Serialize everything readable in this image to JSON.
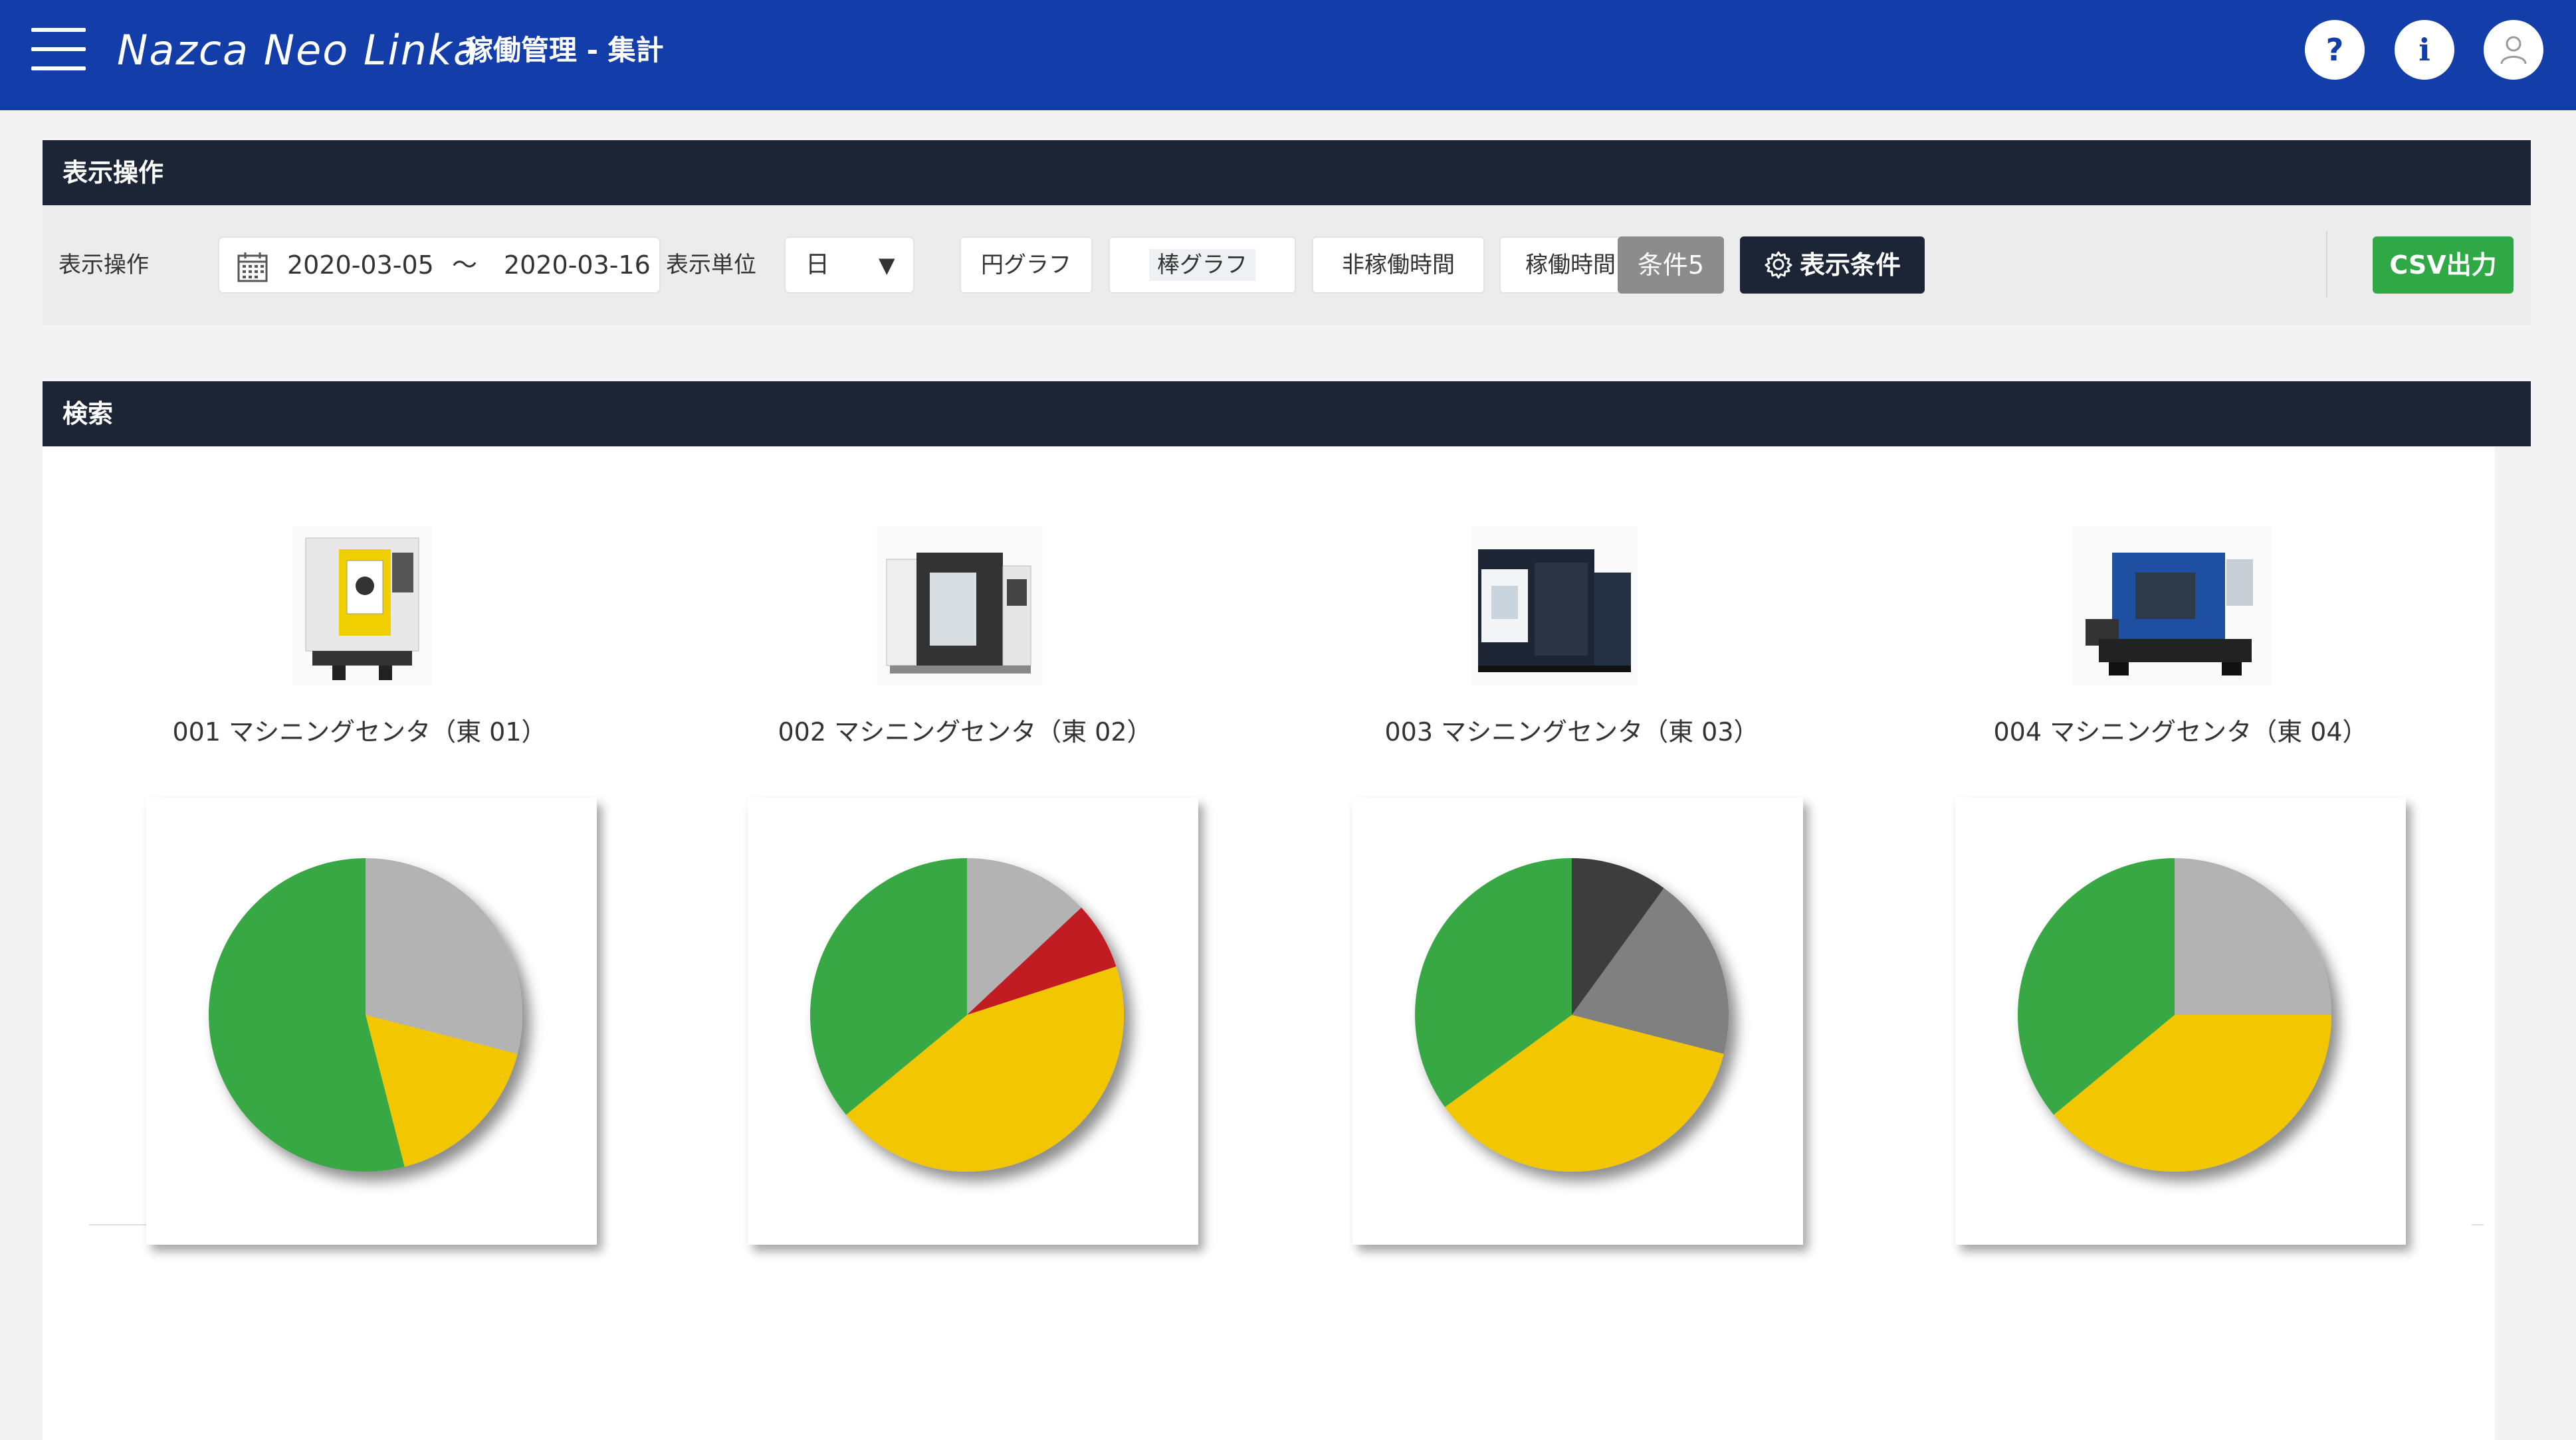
{
  "header": {
    "brand": "Nazca Neo Linka",
    "title": "稼働管理 - 集計",
    "help_icon": "?",
    "info_icon": "i",
    "colors": {
      "bar": "#133ea9"
    }
  },
  "display_panel": {
    "title": "表示操作",
    "label": "表示操作",
    "date_from": "2020-03-05",
    "date_separator": "〜",
    "date_to": "2020-03-16",
    "unit_label": "表示単位",
    "unit_value": "日",
    "unit_arrow": "▼",
    "buttons": {
      "pie": "円グラフ",
      "bar": "棒グラフ",
      "non_operating": "非稼働時間",
      "operating": "稼働時間",
      "condition_count": "条件5",
      "display_conditions": "表示条件",
      "csv": "CSV出力"
    }
  },
  "search_panel": {
    "title": "検索"
  },
  "machines": [
    {
      "label": "001 マシニングセンタ（東 01）"
    },
    {
      "label": "002 マシニングセンタ（東 02）"
    },
    {
      "label": "003 マシニングセンタ（東 03）"
    },
    {
      "label": "004 マシニングセンタ（東 04）"
    }
  ],
  "chart_data": [
    {
      "type": "pie",
      "slices": [
        {
          "color": "#b3b3b3",
          "value": 29
        },
        {
          "color": "#f2c600",
          "value": 17
        },
        {
          "color": "#38a845",
          "value": 54
        }
      ]
    },
    {
      "type": "pie",
      "slices": [
        {
          "color": "#b3b3b3",
          "value": 13
        },
        {
          "color": "#c01a20",
          "value": 7
        },
        {
          "color": "#f2c600",
          "value": 44
        },
        {
          "color": "#38a845",
          "value": 36
        }
      ]
    },
    {
      "type": "pie",
      "slices": [
        {
          "color": "#3d3d3d",
          "value": 10
        },
        {
          "color": "#808080",
          "value": 19
        },
        {
          "color": "#f2c600",
          "value": 36
        },
        {
          "color": "#38a845",
          "value": 35
        }
      ]
    },
    {
      "type": "pie",
      "slices": [
        {
          "color": "#b3b3b3",
          "value": 25
        },
        {
          "color": "#f2c600",
          "value": 39
        },
        {
          "color": "#38a845",
          "value": 36
        }
      ]
    }
  ]
}
